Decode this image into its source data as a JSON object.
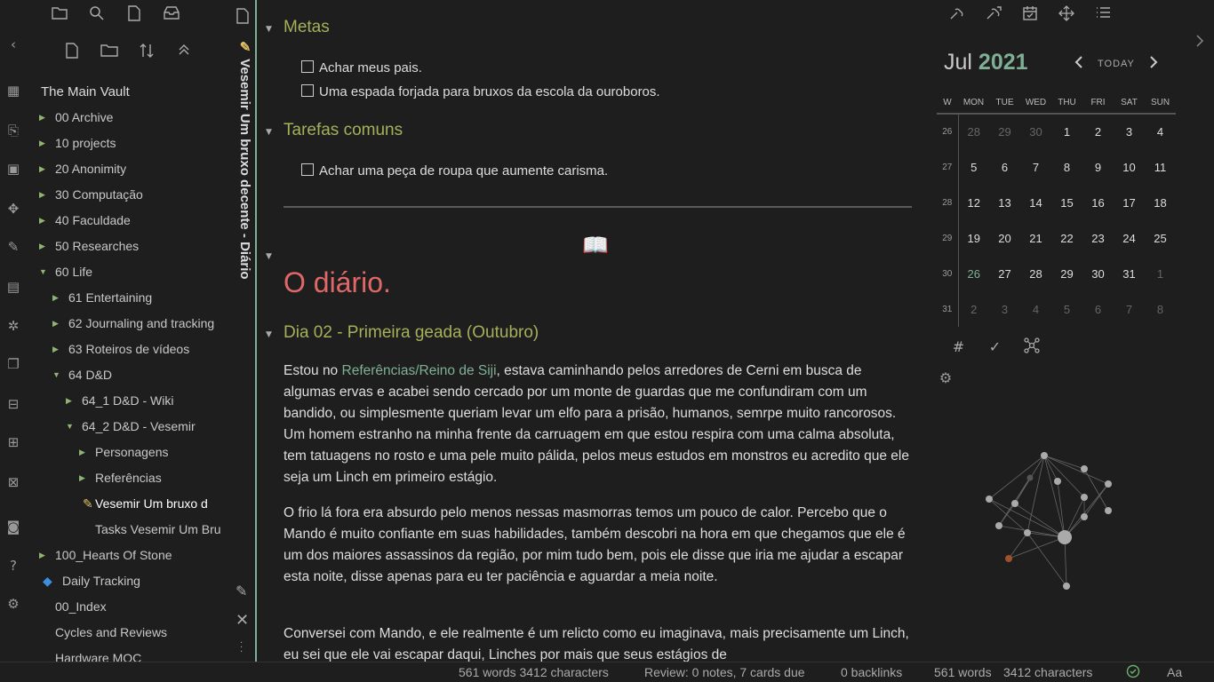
{
  "sidebar": {
    "vault_title": "The Main Vault",
    "items": [
      {
        "label": "00 Archive",
        "level": 0,
        "arrow": "right"
      },
      {
        "label": "10 projects",
        "level": 0,
        "arrow": "right"
      },
      {
        "label": "20 Anonimity",
        "level": 0,
        "arrow": "right"
      },
      {
        "label": "30 Computação",
        "level": 0,
        "arrow": "right"
      },
      {
        "label": "40 Faculdade",
        "level": 0,
        "arrow": "right"
      },
      {
        "label": "50 Researches",
        "level": 0,
        "arrow": "right"
      },
      {
        "label": "60 Life",
        "level": 0,
        "arrow": "down"
      },
      {
        "label": "61 Entertaining",
        "level": 1,
        "arrow": "right"
      },
      {
        "label": "62 Journaling and tracking",
        "level": 1,
        "arrow": "right"
      },
      {
        "label": "63 Roteiros de vídeos",
        "level": 1,
        "arrow": "right"
      },
      {
        "label": "64 D&D",
        "level": 1,
        "arrow": "down"
      },
      {
        "label": "64_1 D&D - Wiki",
        "level": 2,
        "arrow": "right"
      },
      {
        "label": "64_2 D&D - Vesemir",
        "level": 2,
        "arrow": "down"
      },
      {
        "label": "Personagens",
        "level": 3,
        "arrow": "right"
      },
      {
        "label": "Referências",
        "level": 3,
        "arrow": "right"
      },
      {
        "label": "Vesemir Um bruxo d",
        "level": 3,
        "arrow": "",
        "icon": "pencil-icon",
        "active": true
      },
      {
        "label": "Tasks Vesemir Um Bru",
        "level": 3,
        "arrow": ""
      },
      {
        "label": "100_Hearts Of Stone",
        "level": 0,
        "arrow": "right"
      },
      {
        "label": "Daily Tracking",
        "level": 0,
        "arrow": "",
        "icon": "diamond-icon"
      },
      {
        "label": "00_Index",
        "level": 0,
        "arrow": ""
      },
      {
        "label": "Cycles and Reviews",
        "level": 0,
        "arrow": ""
      },
      {
        "label": "Hardware MOC",
        "level": 0,
        "arrow": ""
      }
    ]
  },
  "pane": {
    "title": "Vesemir Um bruxo decente - Diário"
  },
  "editor": {
    "metas_heading": "Metas",
    "metas_tasks": [
      "Achar meus pais.",
      "Uma espada forjada para bruxos da escola da ouroboros."
    ],
    "tarefas_heading": "Tarefas comuns",
    "tarefas_tasks": [
      "Achar uma peça de roupa que aumente carisma."
    ],
    "diario_heading": "O diário.",
    "day_heading": "Dia 02 - Primeira geada (Outubro)",
    "p1_before": "Estou no ",
    "p1_link": "Referências/Reino de Siji",
    "p1_after": ", estava caminhando pelos arredores de Cerni em busca de algumas ervas e acabei sendo cercado por um monte de guardas que me confundiram com um bandido, ou simplesmente queriam levar um elfo para a prisão, humanos, semrpe muito rancorosos. Um homem estranho na minha frente da carruagem em que estou respira com uma calma absoluta, tem tatuagens no rosto e uma pele muito pálida, pelos meus estudos em monstros eu acredito que ele seja um Linch em primeiro estágio.",
    "p2": "O frio lá fora era absurdo pelo menos nessas masmorras temos um pouco de calor. Percebo que o Mando é muito confiante em suas habilidades, também descobri na hora em que chegamos que ele é um dos maiores assassinos da região, por mim tudo bem, pois ele disse que iria me ajudar a escapar esta noite, disse apenas para eu ter paciência e aguardar a meia noite.",
    "p3": "Conversei com Mando, e ele realmente é um relicto como eu imaginava, mais precisamente um Linch, eu sei que ele vai escapar daqui, Linches por mais que seus estágios de"
  },
  "calendar": {
    "month": "Jul",
    "year": "2021",
    "today_label": "TODAY",
    "headers": [
      "W",
      "MON",
      "TUE",
      "WED",
      "THU",
      "FRI",
      "SAT",
      "SUN"
    ],
    "weeks": [
      {
        "wk": "26",
        "days": [
          "28",
          "29",
          "30",
          "1",
          "2",
          "3",
          "4"
        ],
        "dim": [
          0,
          1,
          2
        ]
      },
      {
        "wk": "27",
        "days": [
          "5",
          "6",
          "7",
          "8",
          "9",
          "10",
          "11"
        ],
        "dim": []
      },
      {
        "wk": "28",
        "days": [
          "12",
          "13",
          "14",
          "15",
          "16",
          "17",
          "18"
        ],
        "dim": []
      },
      {
        "wk": "29",
        "days": [
          "19",
          "20",
          "21",
          "22",
          "23",
          "24",
          "25"
        ],
        "dim": []
      },
      {
        "wk": "30",
        "days": [
          "26",
          "27",
          "28",
          "29",
          "30",
          "31",
          "1"
        ],
        "dim": [
          6
        ],
        "today": 0
      },
      {
        "wk": "31",
        "days": [
          "2",
          "3",
          "4",
          "5",
          "6",
          "7",
          "8"
        ],
        "dim": [
          0,
          1,
          2,
          3,
          4,
          5,
          6
        ]
      }
    ]
  },
  "status": {
    "words_chars_left": "561 words 3412 characters",
    "review": "Review: 0 notes, 7 cards due",
    "backlinks": "0 backlinks",
    "words": "561 words",
    "characters": "3412 characters",
    "font_label": "Aa"
  },
  "colors": {
    "accent": "#7fb096",
    "heading2": "#a6b05a",
    "heading1": "#e06868"
  }
}
